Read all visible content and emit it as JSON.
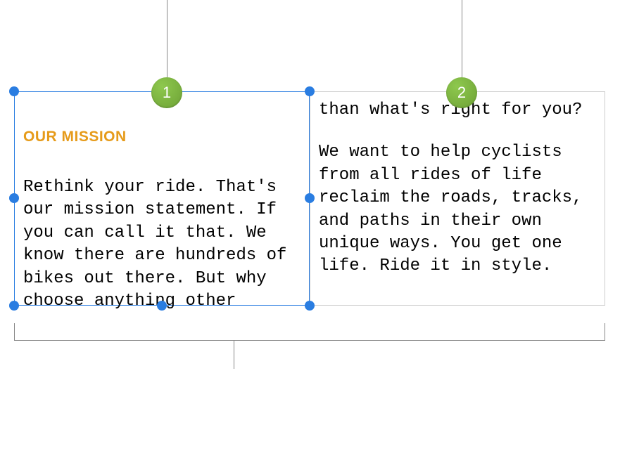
{
  "callouts": {
    "badge1": "1",
    "badge2": "2"
  },
  "textbox_left": {
    "heading": "OUR MISSION",
    "body": "Rethink your ride. That's our mission statement. If you can call it that. We know there are hundreds of bikes out there. But why choose anything other"
  },
  "textbox_right": {
    "body_line1": "than what's right for you?",
    "body_para2": "We want to help cyclists from all rides of life reclaim the roads, tracks, and paths in their own unique ways. You get one life. Ride it in style."
  },
  "colors": {
    "badge_bg": "#7eb33f",
    "selection_blue": "#2a7de1",
    "heading_orange": "#e69b1a"
  }
}
